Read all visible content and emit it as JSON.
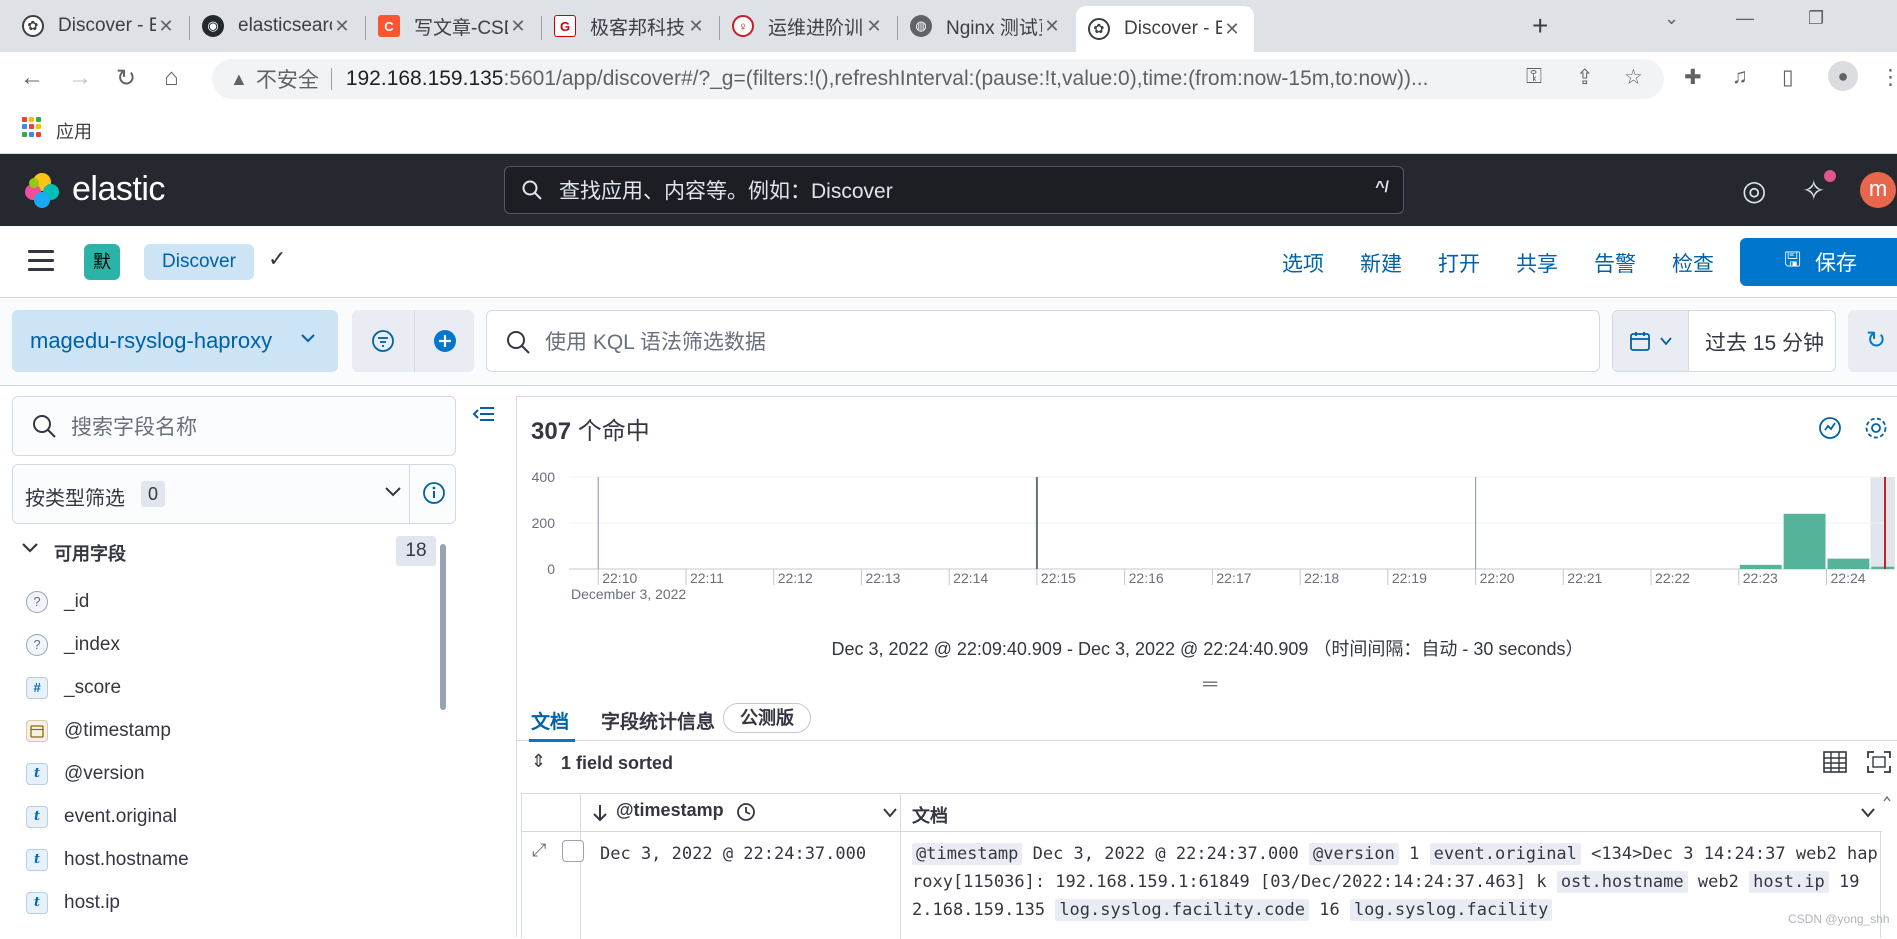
{
  "browser": {
    "tabs": [
      {
        "label": "Discover - Ela",
        "icon": "kibana-icon"
      },
      {
        "label": "elasticsearch-",
        "icon": "github-icon"
      },
      {
        "label": "写文章-CSDN",
        "icon": "csdn-icon"
      },
      {
        "label": "极客邦科技",
        "icon": "infoq-icon"
      },
      {
        "label": "运维进阶训练营",
        "icon": "gitee-icon"
      },
      {
        "label": "Nginx 测试页面",
        "icon": "globe-icon"
      },
      {
        "label": "Discover - Ela",
        "icon": "kibana-icon"
      }
    ],
    "active_tab": 6,
    "url_insecure_label": "不安全",
    "url_host": "192.168.159.135",
    "url_path": ":5601/app/discover#/?_g=(filters:!(),refreshInterval:(pause:!t,value:0),time:(from:now-15m,to:now))...",
    "bookmarks": [
      {
        "label": "应用"
      }
    ]
  },
  "kibana_header": {
    "brand": "elastic",
    "search_placeholder": "查找应用、内容等。例如：Discover",
    "search_shortcut": "^/",
    "avatar_letter": "m"
  },
  "toolbar": {
    "space_letter": "默",
    "breadcrumb": "Discover",
    "menu": [
      "选项",
      "新建",
      "打开",
      "共享",
      "告警",
      "检查"
    ],
    "save_label": "保存"
  },
  "querybar": {
    "data_view": "magedu-rsyslog-haproxy",
    "kql_placeholder": "使用 KQL 语法筛选数据",
    "time_range": "过去 15 分钟"
  },
  "sidebar": {
    "field_search_placeholder": "搜索字段名称",
    "type_filter_label": "按类型筛选",
    "type_filter_count": "0",
    "available_fields_label": "可用字段",
    "available_fields_count": "18",
    "fields": [
      {
        "name": "_id",
        "type": "unknown",
        "token": "?"
      },
      {
        "name": "_index",
        "type": "unknown",
        "token": "?"
      },
      {
        "name": "_score",
        "type": "number",
        "token": "#"
      },
      {
        "name": "@timestamp",
        "type": "date",
        "token": "cal"
      },
      {
        "name": "@version",
        "type": "string",
        "token": "t"
      },
      {
        "name": "event.original",
        "type": "string",
        "token": "t"
      },
      {
        "name": "host.hostname",
        "type": "string",
        "token": "t"
      },
      {
        "name": "host.ip",
        "type": "string",
        "token": "t"
      }
    ]
  },
  "main": {
    "hits_count": "307",
    "hits_suffix": "个命中",
    "range_text": "Dec 3, 2022 @ 22:09:40.909 - Dec 3, 2022 @ 22:24:40.909 （时间间隔：自动 - 30 seconds）",
    "tabs": [
      "文档",
      "字段统计信息"
    ],
    "beta_label": "公测版",
    "sort_label": "1 field sorted",
    "col_timestamp": "@timestamp",
    "col_document": "文档",
    "row": {
      "timestamp": "Dec 3, 2022 @ 22:24:37.000",
      "doc_segments": [
        {
          "k": "@timestamp",
          "v": "Dec 3, 2022 @ 22:24:37.000"
        },
        {
          "k": "@version",
          "v": "1"
        },
        {
          "k": "event.original",
          "v": "<134>Dec 3 14:24:37 web2 haproxy[115036]: 192.168.159.1:61849 [03/Dec/2022:14:24:37.463] k"
        },
        {
          "k": "ost.hostname",
          "v": "web2"
        },
        {
          "k": "host.ip",
          "v": "192.168.159.135"
        },
        {
          "k": "log.syslog.facility.code",
          "v": "16"
        },
        {
          "k": "log.syslog.facility",
          "v": ""
        }
      ]
    }
  },
  "chart_data": {
    "type": "bar",
    "title": "",
    "x_date_label": "December 3, 2022",
    "x_ticks": [
      "22:10",
      "22:11",
      "22:12",
      "22:13",
      "22:14",
      "22:15",
      "22:16",
      "22:17",
      "22:18",
      "22:19",
      "22:20",
      "22:21",
      "22:22",
      "22:23",
      "22:24"
    ],
    "y_ticks": [
      0,
      200,
      400
    ],
    "ylim": [
      0,
      400
    ],
    "xlim": [
      "22:09:40",
      "22:24:40"
    ],
    "bin_seconds": 30,
    "bars": [
      {
        "start": "22:23:00",
        "value": 18
      },
      {
        "start": "22:23:30",
        "value": 240
      },
      {
        "start": "22:24:00",
        "value": 45
      },
      {
        "start": "22:24:30",
        "value": 10
      }
    ],
    "vertical_markers": [
      "22:10:00",
      "22:15:00",
      "22:20:00"
    ],
    "now_marker": "22:24:40",
    "bar_color": "#54b399",
    "now_color": "#bd271e",
    "partial_bucket_start": "22:24:30"
  },
  "watermark": "CSDN @yong_shh"
}
